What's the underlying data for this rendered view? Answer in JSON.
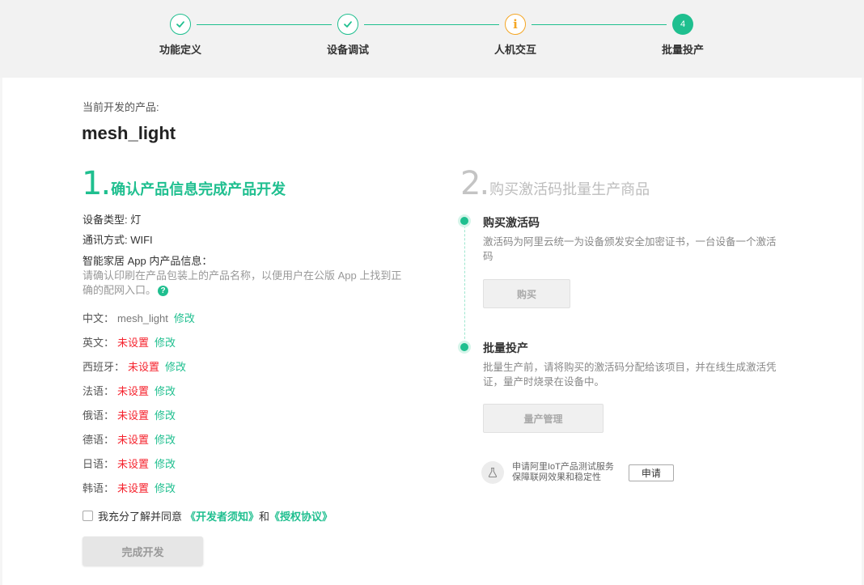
{
  "stepper": {
    "steps": [
      {
        "label": "功能定义",
        "status": "done"
      },
      {
        "label": "设备调试",
        "status": "done"
      },
      {
        "label": "人机交互",
        "status": "warning",
        "icon_text": "i"
      },
      {
        "label": "批量投产",
        "status": "current",
        "number": "4"
      }
    ],
    "colors": {
      "done": "#1fbf8f",
      "warning": "#f5a623",
      "current": "#1fbf8f"
    }
  },
  "product": {
    "label": "当前开发的产品:",
    "name": "mesh_light"
  },
  "section1": {
    "number": "1.",
    "title": "确认产品信息完成产品开发",
    "device_type": "设备类型: 灯",
    "comm_method": "通讯方式: WIFI",
    "smart_home_info": "智能家居 App 内产品信息：",
    "hint": "请确认印刷在产品包装上的产品名称，以便用户在公版 App 上找到正确的配网入口。",
    "help_icon_text": "?",
    "languages": [
      {
        "label": "中文：",
        "value": "mesh_light",
        "unset": false,
        "edit": "修改"
      },
      {
        "label": "英文：",
        "value": "未设置",
        "unset": true,
        "edit": "修改"
      },
      {
        "label": "西班牙：",
        "value": "未设置",
        "unset": true,
        "edit": "修改"
      },
      {
        "label": "法语：",
        "value": "未设置",
        "unset": true,
        "edit": "修改"
      },
      {
        "label": "俄语：",
        "value": "未设置",
        "unset": true,
        "edit": "修改"
      },
      {
        "label": "德语：",
        "value": "未设置",
        "unset": true,
        "edit": "修改"
      },
      {
        "label": "日语：",
        "value": "未设置",
        "unset": true,
        "edit": "修改"
      },
      {
        "label": "韩语：",
        "value": "未设置",
        "unset": true,
        "edit": "修改"
      }
    ],
    "agreement": {
      "checked": false,
      "lead": "我充分了解并同意",
      "link1": "《开发者须知》",
      "and": "和",
      "link2": "《授权协议》"
    },
    "finish_button": "完成开发"
  },
  "section2": {
    "number": "2.",
    "title": "购买激活码批量生产商品",
    "buy": {
      "title": "购买激活码",
      "desc": "激活码为阿里云统一为设备颁发安全加密证书，一台设备一个激活码",
      "button": "购买"
    },
    "mass": {
      "title": "批量投产",
      "desc": "批量生产前，请将购买的激活码分配给该项目，并在线生成激活凭证，量产时烧录在设备中。",
      "button": "量产管理"
    },
    "service": {
      "line1": "申请阿里IoT产品测试服务",
      "line2": "保障联网效果和稳定性",
      "button": "申请",
      "icon": "flask-icon"
    }
  },
  "colors": {
    "accent": "#1fbf8f",
    "unset": "#f5222d",
    "warning": "#f5a623"
  }
}
